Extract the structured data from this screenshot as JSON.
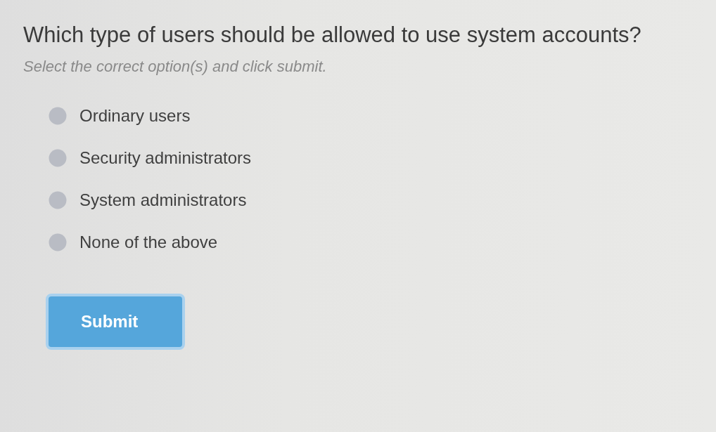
{
  "question": {
    "title": "Which type of users should be allowed to use system accounts?",
    "instruction": "Select the correct option(s) and click submit."
  },
  "options": [
    {
      "label": "Ordinary users",
      "selected": false
    },
    {
      "label": "Security administrators",
      "selected": false
    },
    {
      "label": "System administrators",
      "selected": false
    },
    {
      "label": "None of the above",
      "selected": false
    }
  ],
  "submit_button": {
    "label": "Submit"
  }
}
